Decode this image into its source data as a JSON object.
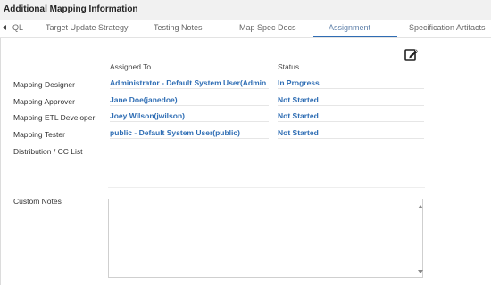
{
  "header": {
    "title": "Additional Mapping Information"
  },
  "tabs": [
    {
      "label": "QL"
    },
    {
      "label": "Target Update Strategy"
    },
    {
      "label": "Testing Notes"
    },
    {
      "label": "Map Spec Docs"
    },
    {
      "label": "Assignment"
    },
    {
      "label": "Specification Artifacts"
    }
  ],
  "active_tab": "Assignment",
  "columns": {
    "assigned_to": "Assigned To",
    "status": "Status"
  },
  "rows": [
    {
      "label": "Mapping Designer",
      "assigned": "Administrator - Default System User(Admin",
      "status": "In Progress"
    },
    {
      "label": "Mapping Approver",
      "assigned": "Jane Doe(janedoe)",
      "status": "Not Started"
    },
    {
      "label": "Mapping ETL Developer",
      "assigned": "Joey Wilson(jwilson)",
      "status": "Not Started"
    },
    {
      "label": "Mapping Tester",
      "assigned": "public - Default System User(public)",
      "status": "Not Started"
    }
  ],
  "distribution_label": "Distribution / CC List",
  "custom_notes": {
    "label": "Custom Notes",
    "value": ""
  },
  "icons": {
    "edit": "edit-icon",
    "scroll_left": "chevron-left-icon"
  },
  "colors": {
    "link": "#2e6db4",
    "active_tab_underline": "#2f6cb3"
  }
}
